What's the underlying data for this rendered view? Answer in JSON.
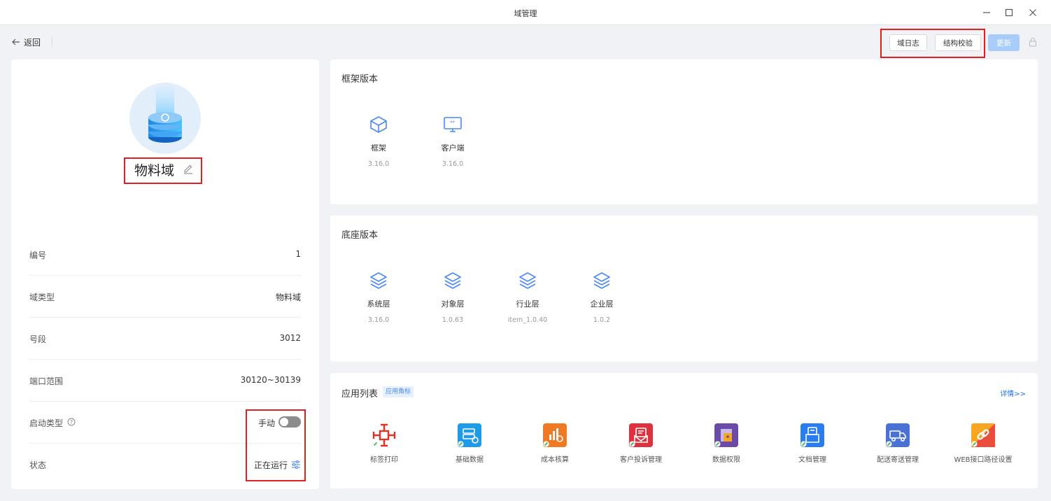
{
  "window": {
    "title": "域管理"
  },
  "toolbar": {
    "back_label": "返回",
    "domain_log_label": "域日志",
    "structure_check_label": "结构校验",
    "update_label": "更新"
  },
  "domain": {
    "name": "物料域",
    "fields": {
      "id_label": "编号",
      "id_value": "1",
      "type_label": "域类型",
      "type_value": "物料域",
      "segment_label": "号段",
      "segment_value": "3012",
      "port_label": "端口范围",
      "port_value": "30120~30139",
      "start_label": "启动类型",
      "start_value": "手动",
      "start_auto": false,
      "status_label": "状态",
      "status_value": "正在运行"
    }
  },
  "framework": {
    "title": "框架版本",
    "items": [
      {
        "name": "框架",
        "version": "3.16.0",
        "icon": "box-icon"
      },
      {
        "name": "客户端",
        "version": "3.16.0",
        "icon": "monitor-icon"
      }
    ]
  },
  "base": {
    "title": "底座版本",
    "items": [
      {
        "name": "系统层",
        "version": "3.16.0",
        "icon": "layers-icon"
      },
      {
        "name": "对象层",
        "version": "1.0.63",
        "icon": "layers-icon"
      },
      {
        "name": "行业层",
        "version": "item_1.0.40",
        "icon": "layers-icon"
      },
      {
        "name": "企业层",
        "version": "1.0.2",
        "icon": "layers-icon"
      }
    ]
  },
  "apps": {
    "title": "应用列表",
    "tag": "应用角标",
    "detail_label": "详情>>",
    "items": [
      {
        "name": "标签打印",
        "color": "#e0312b"
      },
      {
        "name": "基础数据",
        "color": "#1e9be8"
      },
      {
        "name": "成本核算",
        "color": "#f07a24"
      },
      {
        "name": "客户投诉管理",
        "color": "#e0303e"
      },
      {
        "name": "数据权限",
        "color": "#6b4aa8"
      },
      {
        "name": "文档管理",
        "color": "#2a7df0"
      },
      {
        "name": "配送寄送管理",
        "color": "#4a72d6"
      },
      {
        "name": "WEB接口路径设置",
        "color": "#f5a623"
      }
    ]
  },
  "colors": {
    "accent": "#4a8af4",
    "highlight": "#e02020",
    "toggle_off": "#8c8c8c"
  }
}
